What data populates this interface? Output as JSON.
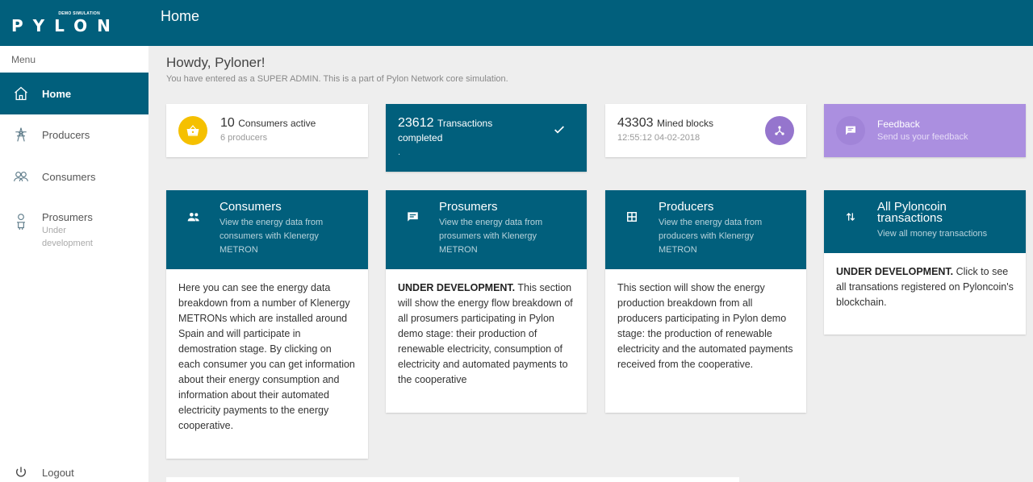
{
  "brand": {
    "demo_label": "DEMO SIMULATION",
    "word": "PYLON"
  },
  "header": {
    "title": "Home"
  },
  "sidebar": {
    "menu_label": "Menu",
    "items": [
      {
        "label": "Home",
        "icon": "home-icon",
        "active": true
      },
      {
        "label": "Producers",
        "icon": "tower-icon"
      },
      {
        "label": "Consumers",
        "icon": "people-icon"
      },
      {
        "label": "Prosumers",
        "sub": "Under development",
        "icon": "user-plug-icon"
      }
    ],
    "logout": "Logout"
  },
  "greeting": {
    "title": "Howdy, Pyloner!",
    "subtitle": "You have entered as a SUPER ADMIN. This is a part of Pylon Network core simulation."
  },
  "stats": [
    {
      "value": "10",
      "label": "Consumers active",
      "sub": "6 producers",
      "icon": "basket-icon",
      "color": "#f5c000"
    },
    {
      "value": "23612",
      "label": "Transactions completed",
      "sub": ".",
      "icon": "check-icon"
    },
    {
      "value": "43303",
      "label": "Mined blocks",
      "sub": "12:55:12 04-02-2018",
      "icon": "share-icon",
      "color": "#9575cd"
    },
    {
      "value": "Feedback",
      "sub": "Send us your feedback",
      "icon": "chat-icon",
      "color": "#ab8fe0"
    }
  ],
  "cards": [
    {
      "title": "Consumers",
      "desc": "View the energy data from consumers with Klenergy METRON",
      "icon": "group-icon",
      "bold": "",
      "body": "Here you can see the energy data breakdown from a number of Klenergy METRONs which are installed around Spain and will participate in demostration stage. By clicking on each consumer you can get information about their energy consumption and information about their automated electricity payments to the energy cooperative."
    },
    {
      "title": "Prosumers",
      "desc": "View the energy data from prosumers with Klenergy METRON",
      "icon": "message-icon",
      "bold": "UNDER DEVELOPMENT.",
      "body": " This section will show the energy flow breakdown of all prosumers participating in Pylon demo stage: their production of renewable electricity, consumption of electricity and automated payments to the cooperative"
    },
    {
      "title": "Producers",
      "desc": "View the energy data from producers with Klenergy METRON",
      "icon": "grid-icon",
      "bold": "",
      "body": "This section will show the energy production breakdown from all producers participating in Pylon demo stage: the production of renewable electricity and the automated payments received from the cooperative."
    },
    {
      "title": "All Pyloncoin transactions",
      "desc": "View all money transactions",
      "icon": "swap-icon",
      "bold": "UNDER DEVELOPMENT.",
      "body": " Click to see all transations registered on Pyloncoin's blockchain."
    }
  ],
  "colors": {
    "primary": "#015f7c",
    "background": "#eeeeee"
  }
}
